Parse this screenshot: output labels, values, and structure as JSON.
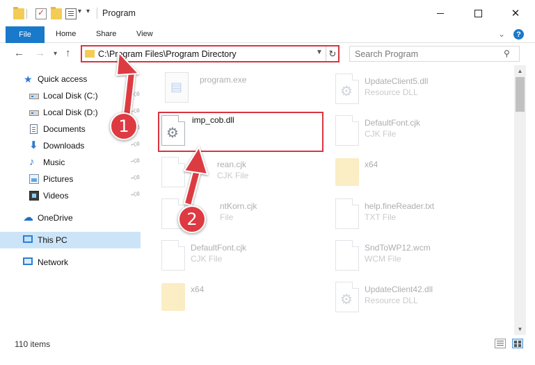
{
  "window": {
    "title": "Program"
  },
  "ribbon": {
    "tabs": [
      "File",
      "Home",
      "Share",
      "View"
    ],
    "help_label": "?"
  },
  "navigation": {
    "address_path": "C:\\Program Files\\Program Directory",
    "search_placeholder": "Search Program"
  },
  "sidebar": {
    "items": [
      {
        "label": "Quick access",
        "icon": "star-icon"
      },
      {
        "label": "Local Disk (C:)",
        "icon": "drive-icon"
      },
      {
        "label": "Local Disk (D:)",
        "icon": "drive-icon"
      },
      {
        "label": "Documents",
        "icon": "documents-icon"
      },
      {
        "label": "Downloads",
        "icon": "download-icon"
      },
      {
        "label": "Music",
        "icon": "music-icon"
      },
      {
        "label": "Pictures",
        "icon": "pictures-icon"
      },
      {
        "label": "Videos",
        "icon": "videos-icon"
      },
      {
        "label": "OneDrive",
        "icon": "cloud-icon"
      },
      {
        "label": "This PC",
        "icon": "computer-icon",
        "selected": true
      },
      {
        "label": "Network",
        "icon": "network-icon"
      }
    ]
  },
  "files": [
    {
      "name": "program.exe",
      "type": "",
      "icon": "exe-icon"
    },
    {
      "name": "imp_cob.dll",
      "type": "",
      "icon": "dll-icon"
    },
    {
      "name": "rean.cjk",
      "type": "CJK File",
      "icon": "file-icon"
    },
    {
      "name": "ntKorn.cjk",
      "type": "File",
      "icon": "file-icon"
    },
    {
      "name": "DefaultFont.cjk",
      "type": "CJK File",
      "icon": "file-icon"
    },
    {
      "name": "x64",
      "type": "",
      "icon": "folder-icon"
    },
    {
      "name": "UpdateClient5.dll",
      "type": "Resource DLL",
      "icon": "dll-icon"
    },
    {
      "name": "DefaultFont.cjk",
      "type": "CJK File",
      "icon": "file-icon"
    },
    {
      "name": "x64",
      "type": "",
      "icon": "folder-icon"
    },
    {
      "name": "help.fineReader.txt",
      "type": "TXT File",
      "icon": "file-icon"
    },
    {
      "name": "SndToWP12.wcm",
      "type": "WCM File",
      "icon": "file-icon"
    },
    {
      "name": "UpdateClient42.dll",
      "type": "Resource DLL",
      "icon": "dll-icon"
    }
  ],
  "status": {
    "item_count": "110 items"
  },
  "annotations": {
    "step1": "1",
    "step2": "2",
    "color": "#dd3a42"
  }
}
